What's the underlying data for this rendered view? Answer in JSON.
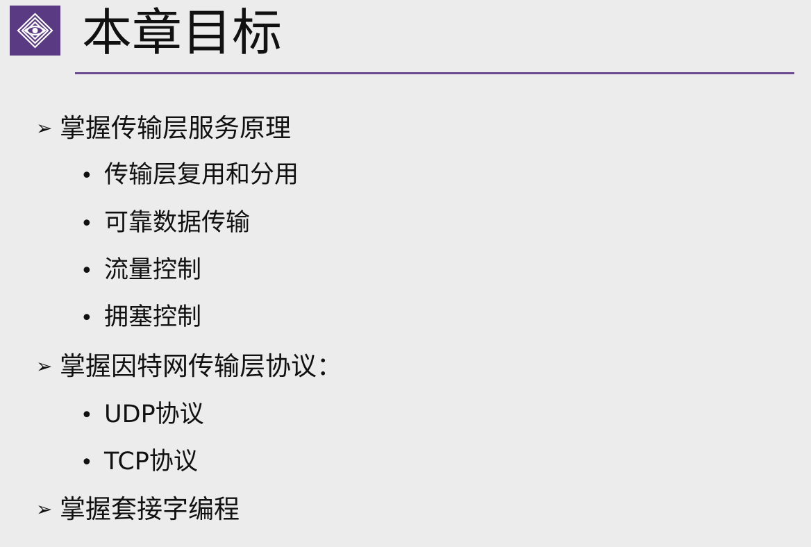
{
  "slide": {
    "title": "本章目标",
    "accent_color": "#5a3b83",
    "rule_color": "#6b4b8f",
    "logo_icon": "eye-diamond-logo-icon",
    "level1_marker": "➢",
    "level2_marker": "•",
    "items": [
      {
        "level": 1,
        "text": "掌握传输层服务原理"
      },
      {
        "level": 2,
        "text": "传输层复用和分用"
      },
      {
        "level": 2,
        "text": "可靠数据传输"
      },
      {
        "level": 2,
        "text": "流量控制"
      },
      {
        "level": 2,
        "text": "拥塞控制"
      },
      {
        "level": 1,
        "text": "掌握因特网传输层协议："
      },
      {
        "level": 2,
        "text": "UDP协议"
      },
      {
        "level": 2,
        "text": "TCP协议"
      },
      {
        "level": 1,
        "text": "掌握套接字编程"
      }
    ]
  }
}
